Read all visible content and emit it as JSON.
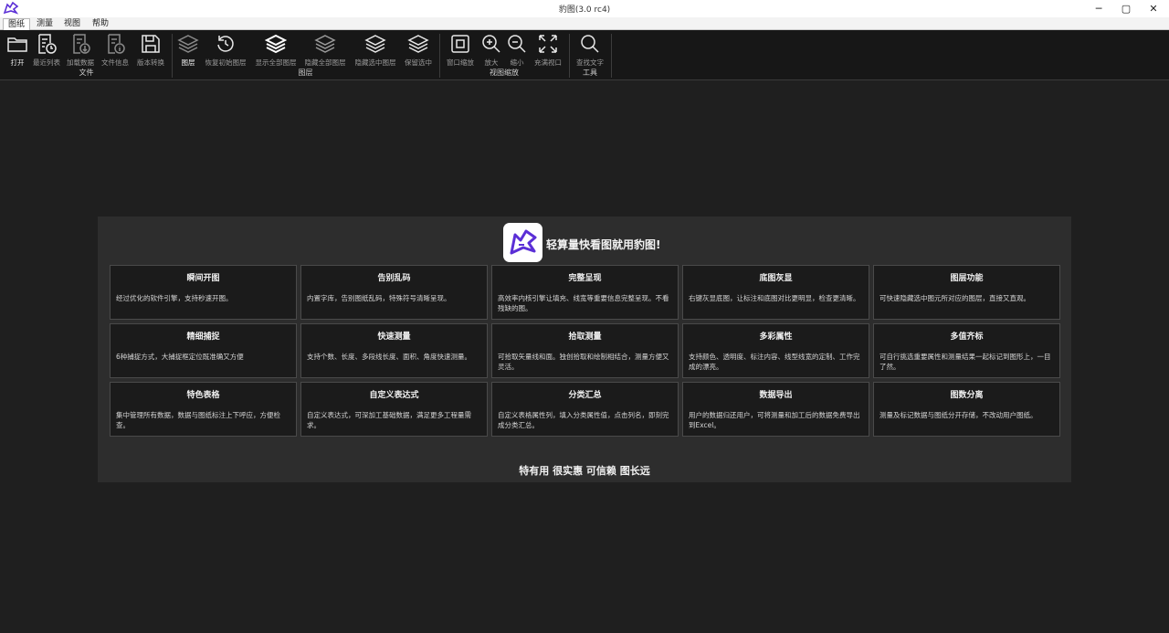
{
  "window": {
    "title": "豹图(3.0 rc4)",
    "controls": [
      "─",
      "▢",
      "✕"
    ]
  },
  "menu": {
    "tabs": [
      {
        "label": "图纸",
        "active": true
      },
      {
        "label": "测量",
        "active": false
      },
      {
        "label": "视图",
        "active": false
      },
      {
        "label": "帮助",
        "active": false
      }
    ]
  },
  "ribbon": {
    "groups": {
      "file": "文件",
      "layers": "图层",
      "zoom": "视图缩放",
      "tools": "工具"
    },
    "buttons": {
      "open": "打开",
      "recent": "最近列表",
      "load_data": "加载数据",
      "file_info": "文件信息",
      "version_convert": "版本转换",
      "layers": "图层",
      "restore_layers": "恢复初始图层",
      "show_all_layers": "显示全部图层",
      "hide_all_layers": "隐藏全部图层",
      "hide_selected_layers": "隐藏选中图层",
      "keep_selected": "保留选中",
      "window_zoom": "窗口缩放",
      "zoom_in": "放大",
      "zoom_out": "缩小",
      "fit_view": "充满视口",
      "find_text": "查找文字"
    },
    "icons": [
      "folder-icon",
      "recent-list-icon",
      "load-data-icon",
      "file-info-icon",
      "save-convert-icon",
      "layers-icon",
      "restore-icon",
      "layers-show-icon",
      "layers-hide-icon",
      "layers-hide-selected-icon",
      "layers-keep-icon",
      "window-zoom-icon",
      "zoom-in-icon",
      "zoom-out-icon",
      "fit-view-icon",
      "search-icon"
    ]
  },
  "promo": {
    "headline": "轻算量快看图就用豹图!",
    "slogan": "特有用 很实惠 可信赖 图长远",
    "brand_color": "#5b2fd6",
    "features": [
      {
        "title": "瞬间开图",
        "desc": "经过优化的软件引擎，支持秒速开图。"
      },
      {
        "title": "告别乱码",
        "desc": "内置字库，告别图纸乱码，特殊符号清晰呈现。"
      },
      {
        "title": "完整呈现",
        "desc": "高效率内核引擎让填充、线宽等重要信息完整呈现。不看残缺的图。"
      },
      {
        "title": "底图灰显",
        "desc": "右键灰显底图，让标注和底图对比更明显，检查更清晰。"
      },
      {
        "title": "图层功能",
        "desc": "可快速隐藏选中图元所对应的图层，直接又直观。"
      },
      {
        "title": "精细捕捉",
        "desc": "6种捕捉方式，大捕捉框定位既准确又方便"
      },
      {
        "title": "快速测量",
        "desc": "支持个数、长度、多段线长度、面积、角度快速测量。"
      },
      {
        "title": "拾取测量",
        "desc": "可拾取矢量线和面。独创拾取和绘制相结合，测量方便又灵活。"
      },
      {
        "title": "多彩属性",
        "desc": "支持颜色、透明度、标注内容、线型线宽的定制、工作完成的漂亮。"
      },
      {
        "title": "多值齐标",
        "desc": "可自行挑选重要属性和测量结果一起标记到图形上，一目了然。"
      },
      {
        "title": "特色表格",
        "desc": "集中管理所有数据，数据与图纸标注上下呼应，方便检查。"
      },
      {
        "title": "自定义表达式",
        "desc": "自定义表达式，可深加工基础数据，满足更多工程量需求。"
      },
      {
        "title": "分类汇总",
        "desc": "自定义表格属性列，填入分类属性值，点击列名，即刻完成分类汇总。"
      },
      {
        "title": "数据导出",
        "desc": "用户的数据归还用户，可将测量和加工后的数据免费导出到Excel。"
      },
      {
        "title": "图数分离",
        "desc": "测量及标记数据与图纸分开存储，不改动用户图纸。"
      }
    ]
  }
}
